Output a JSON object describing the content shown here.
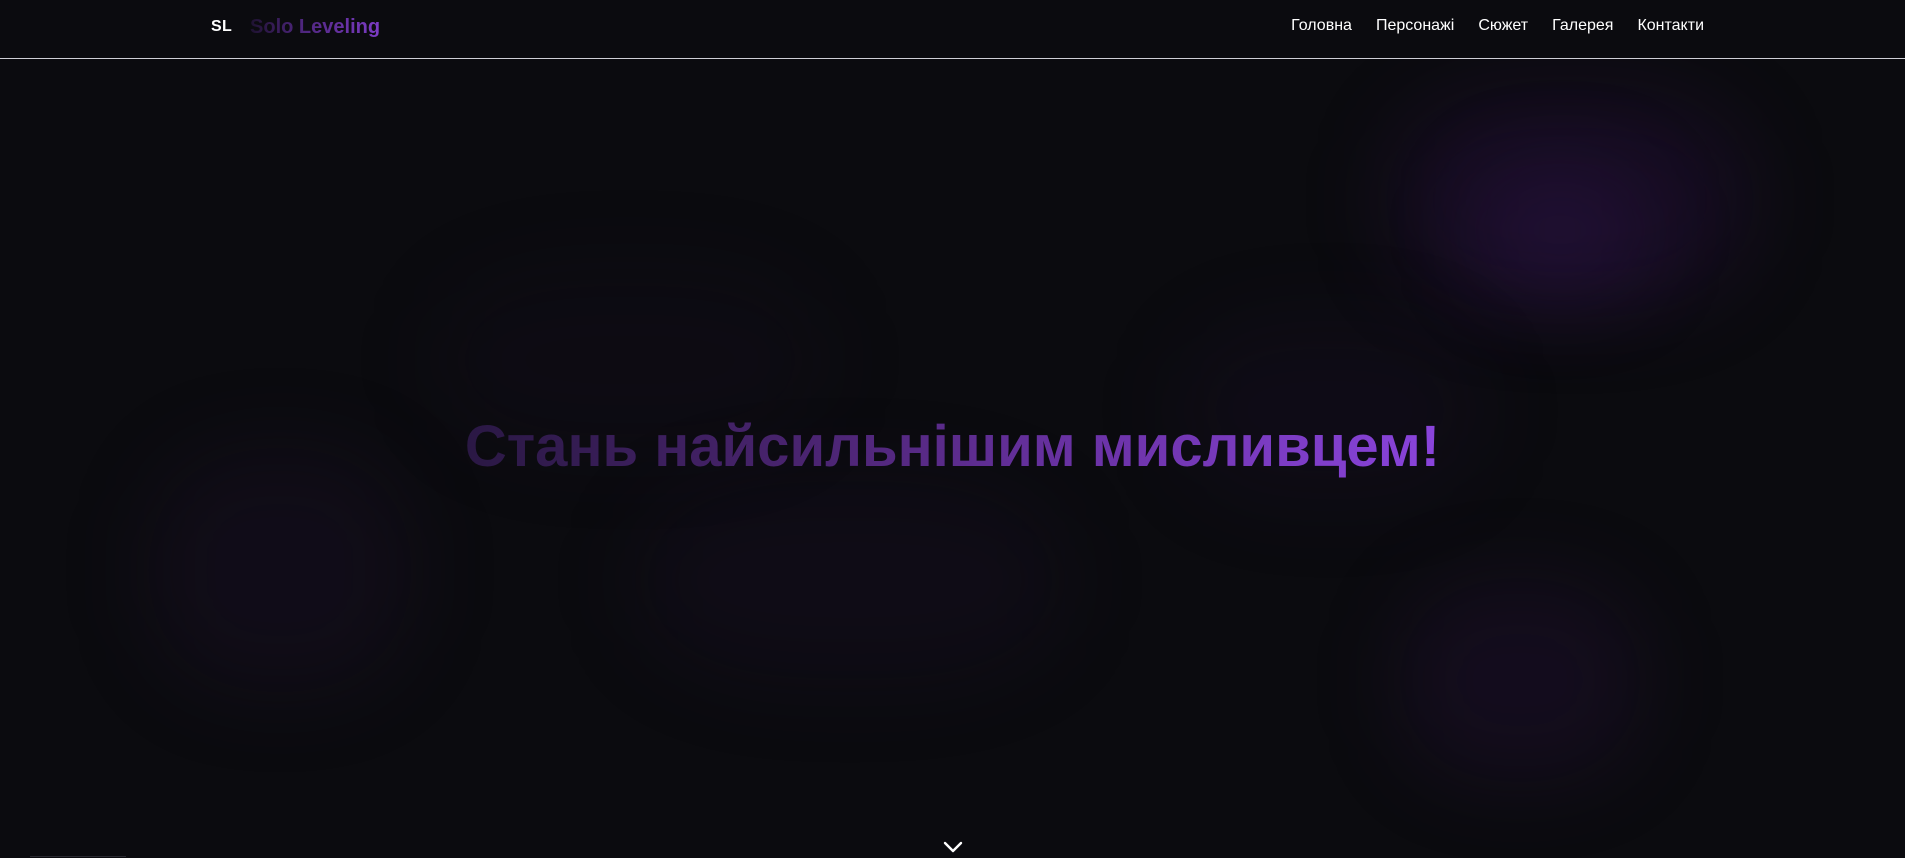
{
  "header": {
    "logo_mark": "SL",
    "logo_text": "Solo Leveling",
    "nav": [
      {
        "label": "Головна"
      },
      {
        "label": "Персонажі"
      },
      {
        "label": "Сюжет"
      },
      {
        "label": "Галерея"
      },
      {
        "label": "Контакти"
      }
    ]
  },
  "hero": {
    "title": "Стань найсильнішим мисливцем!",
    "scroll_icon": "chevron-down-icon"
  },
  "colors": {
    "background": "#0b0b0f",
    "accent": "#8a44dc",
    "accent_dark": "#2a1844",
    "text": "#ffffff",
    "header_border": "#cfcfd6"
  }
}
